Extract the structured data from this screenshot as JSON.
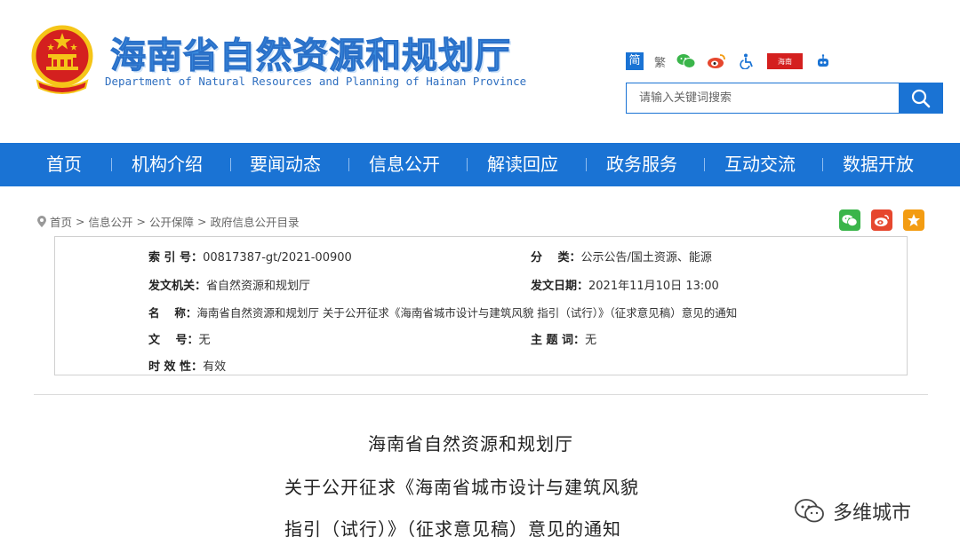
{
  "header": {
    "site_title": "海南省自然资源和规划厅",
    "site_subtitle": "Department of Natural Resources and Planning of Hainan Province",
    "toolbar": {
      "simplified_label": "简",
      "traditional_label": "繁",
      "badge_label": "海南",
      "icons": [
        "wechat-icon",
        "weibo-icon",
        "accessibility-icon",
        "app-badge-icon",
        "robot-icon"
      ]
    },
    "search": {
      "placeholder": "请输入关键词搜索",
      "button_icon": "search-icon"
    },
    "colors": {
      "brand_blue": "#1a73d4",
      "emblem_red": "#d4201f",
      "emblem_gold": "#f5c518"
    }
  },
  "nav": {
    "items": [
      {
        "label": "首页"
      },
      {
        "label": "机构介绍"
      },
      {
        "label": "要闻动态"
      },
      {
        "label": "信息公开"
      },
      {
        "label": "解读回应"
      },
      {
        "label": "政务服务"
      },
      {
        "label": "互动交流"
      },
      {
        "label": "数据开放"
      }
    ]
  },
  "breadcrumb": {
    "items": [
      "首页",
      "信息公开",
      "公开保障",
      "政府信息公开目录"
    ],
    "separator": ">"
  },
  "share": {
    "icons": [
      "wechat-share-icon",
      "weibo-share-icon",
      "favorite-star-icon"
    ],
    "colors": {
      "wechat": "#3ab54a",
      "weibo": "#e6472e",
      "star": "#f39c12"
    }
  },
  "info": {
    "index_label": "索 引 号：",
    "index_value": "00817387-gt/2021-00900",
    "category_label": "分　 类：",
    "category_value": "公示公告/国土资源、能源",
    "issuer_label": "发文机关：",
    "issuer_value": "省自然资源和规划厅",
    "date_label": "发文日期：",
    "date_value": "2021年11月10日 13:00",
    "name_label": "名　 称：",
    "name_value": "海南省自然资源和规划厅 关于公开征求《海南省城市设计与建筑风貌 指引（试行）》（征求意见稿）意见的通知",
    "docno_label": "文　 号：",
    "docno_value": "无",
    "subject_label": "主 题 词：",
    "subject_value": "无",
    "validity_label": "时 效 性：",
    "validity_value": "有效"
  },
  "article": {
    "title_lines": [
      "海南省自然资源和规划厅",
      "关于公开征求《海南省城市设计与建筑风貌",
      "指引（试行）》（征求意见稿）意见的通知"
    ]
  },
  "watermark": {
    "text": "多维城市",
    "icon": "wechat-watermark-icon"
  }
}
